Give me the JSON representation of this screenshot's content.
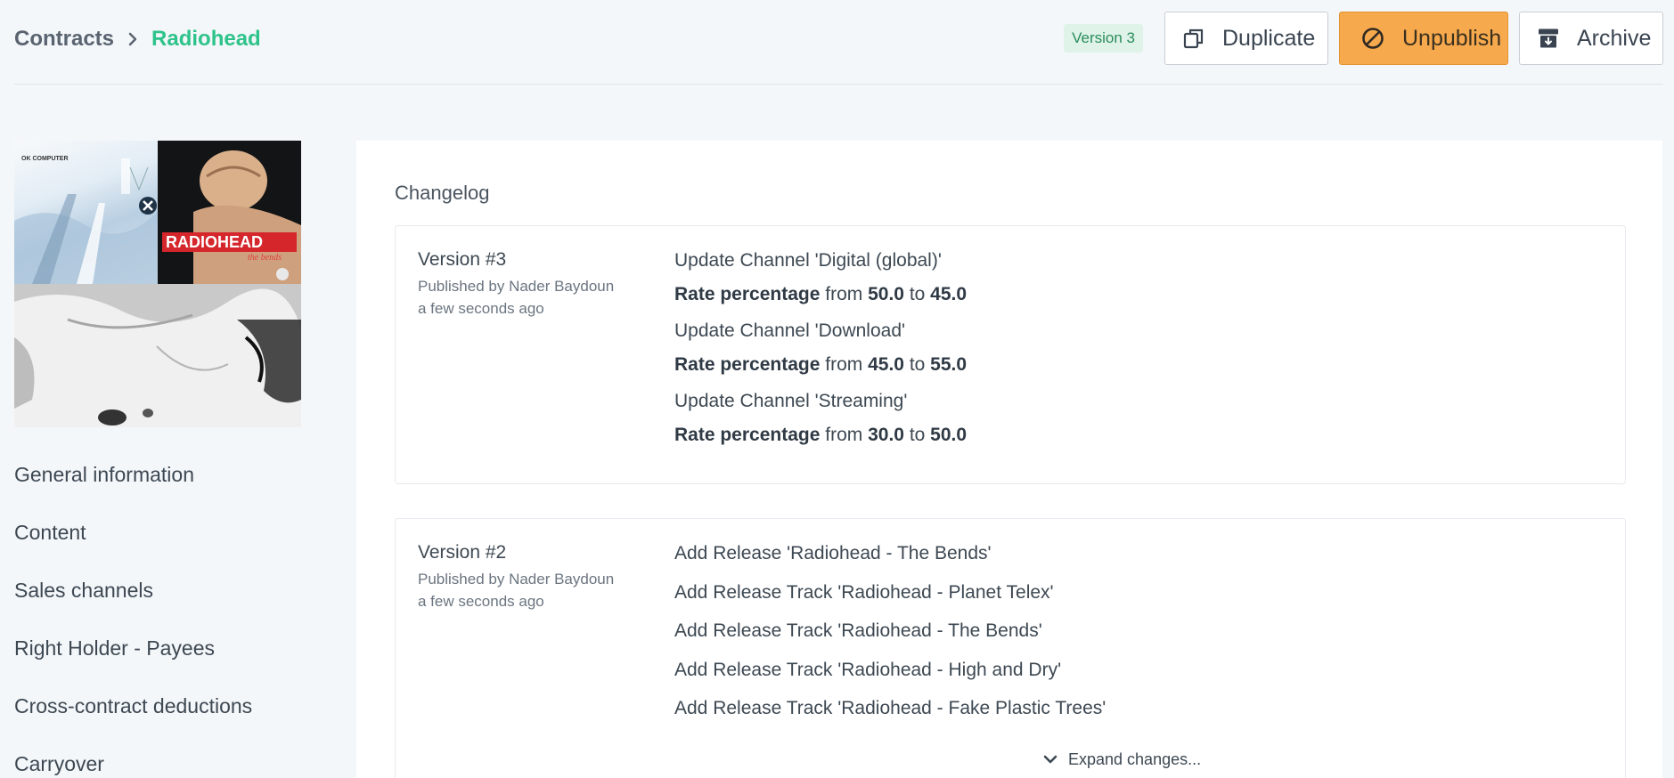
{
  "breadcrumb": {
    "root": "Contracts",
    "current": "Radiohead"
  },
  "header": {
    "version_badge": "Version 3",
    "duplicate_label": "Duplicate",
    "unpublish_label": "Unpublish",
    "archive_label": "Archive"
  },
  "artwork": {
    "ok_computer": "OK COMPUTER",
    "bends_title": "RADIOHEAD",
    "bends_sub": "the bends"
  },
  "sidebar": {
    "items": [
      {
        "label": "General information"
      },
      {
        "label": "Content"
      },
      {
        "label": "Sales channels"
      },
      {
        "label": "Right Holder - Payees"
      },
      {
        "label": "Cross-contract deductions"
      },
      {
        "label": "Carryover"
      }
    ]
  },
  "changelog": {
    "title": "Changelog",
    "versions": [
      {
        "title": "Version #3",
        "published_by": "Published by Nader Baydoun",
        "when": "a few seconds ago",
        "changes": [
          {
            "text": "Update Channel 'Digital (global)'",
            "field": "Rate percentage",
            "from_word": "from",
            "from": "50.0",
            "to_word": "to",
            "to": "45.0"
          },
          {
            "text": "Update Channel 'Download'",
            "field": "Rate percentage",
            "from_word": "from",
            "from": "45.0",
            "to_word": "to",
            "to": "55.0"
          },
          {
            "text": "Update Channel 'Streaming'",
            "field": "Rate percentage",
            "from_word": "from",
            "from": "30.0",
            "to_word": "to",
            "to": "50.0"
          }
        ]
      },
      {
        "title": "Version #2",
        "published_by": "Published by Nader Baydoun",
        "when": "a few seconds ago",
        "changes": [
          {
            "text": "Add Release 'Radiohead - The Bends'"
          },
          {
            "text": "Add Release Track 'Radiohead - Planet Telex'"
          },
          {
            "text": "Add Release Track 'Radiohead - The Bends'"
          },
          {
            "text": "Add Release Track 'Radiohead - High and Dry'"
          },
          {
            "text": "Add Release Track 'Radiohead - Fake Plastic Trees'"
          }
        ],
        "expand_label": "Expand changes..."
      }
    ]
  }
}
